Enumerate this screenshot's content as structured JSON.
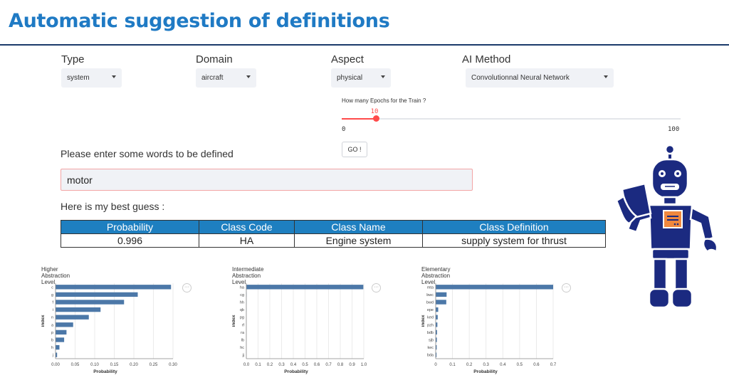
{
  "header": {
    "title": "Automatic suggestion of definitions"
  },
  "controls": {
    "type": {
      "label": "Type",
      "value": "system"
    },
    "domain": {
      "label": "Domain",
      "value": "aircraft"
    },
    "aspect": {
      "label": "Aspect",
      "value": "physical"
    },
    "ai_method": {
      "label": "AI Method",
      "value": "Convolutionnal Neural Network"
    }
  },
  "epochs": {
    "label": "How many Epochs for the Train ?",
    "value": 10,
    "value_text": "10",
    "min": 0,
    "max": 100,
    "min_text": "0",
    "max_text": "100"
  },
  "go_button": {
    "label": "GO !"
  },
  "input": {
    "prompt": "Please enter some words to be defined",
    "value": "motor"
  },
  "result": {
    "caption": "Here is my best guess :",
    "headers": [
      "Probability",
      "Class Code",
      "Class Name",
      "Class Definition"
    ],
    "row": [
      "0.996",
      "HA",
      "Engine system",
      "supply system for thrust"
    ]
  },
  "colors": {
    "accent": "#1f7ac4",
    "slider": "#ff4b4b",
    "bar": "#4c78a8",
    "table_header": "#1e7fc0",
    "robot": "#1b2a80",
    "robot_badge": "#f0883e"
  },
  "icons": {
    "robot": "robot-mascot-icon",
    "more": "more-options-icon"
  },
  "chart_data": [
    {
      "type": "bar",
      "title": "Higher Abstraction Level",
      "xlabel": "Probability",
      "ylabel": "index",
      "categories": [
        "c",
        "g",
        "f",
        "i",
        "n",
        "a",
        "p",
        "b",
        "h",
        "j"
      ],
      "values": [
        0.295,
        0.21,
        0.175,
        0.115,
        0.085,
        0.045,
        0.028,
        0.022,
        0.01,
        0.004
      ],
      "xlim": [
        0,
        0.3
      ],
      "ticks": [
        "0.00",
        "0.05",
        "0.10",
        "0.15",
        "0.20",
        "0.25",
        "0.30"
      ]
    },
    {
      "type": "bar",
      "title": "Intermediate Abstraction Level",
      "xlabel": "Probability",
      "ylabel": "index",
      "categories": [
        "ha",
        "cg",
        "hh",
        "qb",
        "pg",
        "rf",
        "ra",
        "lb",
        "hc",
        "jj"
      ],
      "values": [
        0.996,
        0.002,
        0.001,
        0.001,
        0.0,
        0.0,
        0.0,
        0.0,
        0.0,
        0.0
      ],
      "xlim": [
        0,
        1.0
      ],
      "ticks": [
        "0.0",
        "0.1",
        "0.2",
        "0.3",
        "0.4",
        "0.5",
        "0.6",
        "0.7",
        "0.8",
        "0.9",
        "1.0"
      ]
    },
    {
      "type": "bar",
      "title": "Elementary Abstraction Level",
      "xlabel": "Probability",
      "ylabel": "index",
      "categories": [
        "mta",
        "bwc",
        "bwd",
        "epe",
        "ked",
        "pzh",
        "bdb",
        "sjb",
        "kec",
        "bda"
      ],
      "values": [
        0.7,
        0.065,
        0.063,
        0.015,
        0.012,
        0.01,
        0.008,
        0.007,
        0.006,
        0.005
      ],
      "xlim": [
        0,
        0.7
      ],
      "ticks": [
        "0",
        "0.1",
        "0.2",
        "0.3",
        "0.4",
        "0.5",
        "0.6",
        "0.7"
      ]
    }
  ]
}
